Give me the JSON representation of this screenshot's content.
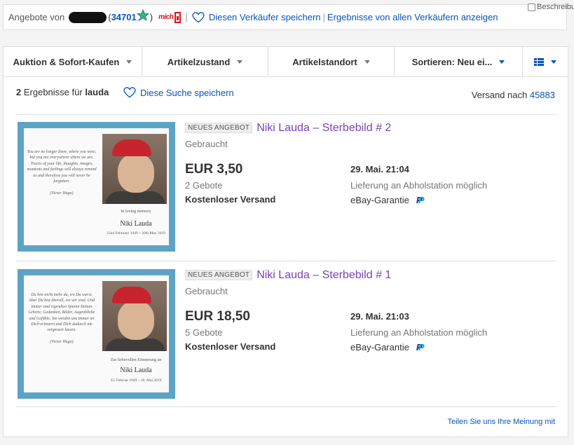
{
  "seller_bar": {
    "label": "Angebote von",
    "score": "34701",
    "paren_open": "(",
    "paren_close": ")",
    "brand": "mich",
    "save_seller": "Diesen Verkäufer speichern",
    "separator": "|",
    "all_sellers": "Ergebnisse von allen Verkäufern anzeigen",
    "checkbox_label": "Beschreibu"
  },
  "filters": [
    {
      "label": "Auktion & Sofort-Kaufen"
    },
    {
      "label": "Artikelzustand"
    },
    {
      "label": "Artikelstandort"
    },
    {
      "label": "Sortieren: Neu ei..."
    }
  ],
  "results": {
    "count": "2",
    "count_text": "Ergebnisse für",
    "query": "lauda",
    "save_search": "Diese Suche speichern",
    "versand_label": "Versand nach",
    "zip": "45883"
  },
  "items": [
    {
      "badge": "NEUES ANGEBOT",
      "title": "Niki Lauda – Sterbebild # 2",
      "condition": "Gebraucht",
      "price": "EUR 3,50",
      "bids": "2 Gebote",
      "shipping": "Kostenloser Versand",
      "end": "29. Mai. 21:04",
      "pickup": "Lieferung an Abholstation möglich",
      "guarantee": "eBay-Garantie",
      "card": {
        "poem": "You are no longer there, where you were, but you are everywhere where we are. Traces of your life, thoughts, images, moments and feelings will always remind us and therefore you will never be forgotten.",
        "poem_author": "(Victor Hugo)",
        "memory": "In loving memory",
        "name": "Niki Lauda",
        "dates": "22nd February 1949 – 20th May 2019"
      }
    },
    {
      "badge": "NEUES ANGEBOT",
      "title": "Niki Lauda – Sterbebild # 1",
      "condition": "Gebraucht",
      "price": "EUR 18,50",
      "bids": "5 Gebote",
      "shipping": "Kostenloser Versand",
      "end": "29. Mai. 21:03",
      "pickup": "Lieferung an Abholstation möglich",
      "guarantee": "eBay-Garantie",
      "card": {
        "poem": "Du bist nicht mehr da, wo Du warst. Aber Du bist überall, wo wir sind. Und immer sind irgendwo Spuren Deines Lebens; Gedanken, Bilder, Augenblicke und Gefühle. Sie werden uns immer an Dich erinnern und Dich dadurch nie vergessen lassen.",
        "poem_author": "(Victor Hugo)",
        "memory": "Zur liebevollen Erinnerung an",
        "name": "Niki Lauda",
        "dates": "22. Februar 1949 – 20. Mai 2019"
      }
    }
  ],
  "feedback": "Teilen Sie uns Ihre Meinung mit"
}
